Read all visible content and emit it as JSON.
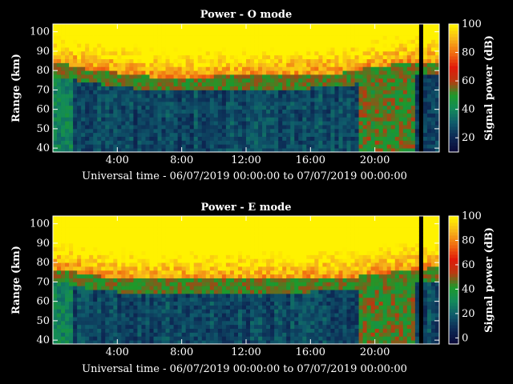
{
  "colors": {
    "background": "#000000",
    "text": "#ffffff",
    "colorscale": [
      "#0b0b3a",
      "#0d2a55",
      "#0f5a6b",
      "#138a5a",
      "#1d9a2a",
      "#b83a10",
      "#e01a0a",
      "#f06a10",
      "#f6b21a",
      "#fff200"
    ]
  },
  "chart_data": [
    {
      "type": "heatmap",
      "title": "Power - O mode",
      "xlabel": "Universal time - 06/07/2019 00:00:00 to 07/07/2019 00:00:00",
      "ylabel": "Range (km)",
      "x_range_hours": [
        0,
        24
      ],
      "y_range_km": [
        38,
        104
      ],
      "xticks": [
        "4:00",
        "8:00",
        "12:00",
        "16:00",
        "20:00"
      ],
      "xtick_hours": [
        4,
        8,
        12,
        16,
        20
      ],
      "yticks": [
        "40",
        "50",
        "60",
        "70",
        "80",
        "90",
        "100"
      ],
      "ytick_km": [
        40,
        50,
        60,
        70,
        80,
        90,
        100
      ],
      "colorbar_label": "Signal power (dB)",
      "colorbar_range": [
        10,
        100
      ],
      "colorbar_ticks": [
        "20",
        "40",
        "60",
        "80",
        "100"
      ],
      "colorbar_tick_values": [
        20,
        40,
        60,
        80,
        100
      ],
      "transition_km_by_hour": {
        "hours": [
          0,
          1,
          2,
          3,
          4,
          6,
          8,
          10,
          12,
          14,
          16,
          18,
          20,
          22,
          23.3
        ],
        "km": [
          79,
          79,
          77,
          76,
          75,
          73,
          72,
          73,
          73,
          73,
          74,
          75,
          78,
          80,
          80
        ]
      },
      "data_gap_hour": 22.9
    },
    {
      "type": "heatmap",
      "title": "Power - E mode",
      "xlabel": "Universal time - 06/07/2019 00:00:00 to 07/07/2019 00:00:00",
      "ylabel": "Range (km)",
      "x_range_hours": [
        0,
        24
      ],
      "y_range_km": [
        38,
        104
      ],
      "xticks": [
        "4:00",
        "8:00",
        "12:00",
        "16:00",
        "20:00"
      ],
      "xtick_hours": [
        4,
        8,
        12,
        16,
        20
      ],
      "yticks": [
        "40",
        "50",
        "60",
        "70",
        "80",
        "90",
        "100"
      ],
      "ytick_km": [
        40,
        50,
        60,
        70,
        80,
        90,
        100
      ],
      "colorbar_label": "Signal power (dB)",
      "colorbar_range": [
        -5,
        100
      ],
      "colorbar_ticks": [
        "0",
        "20",
        "40",
        "60",
        "80",
        "100"
      ],
      "colorbar_tick_values": [
        0,
        20,
        40,
        60,
        80,
        100
      ],
      "transition_km_by_hour": {
        "hours": [
          0,
          1,
          2,
          3,
          4,
          6,
          8,
          10,
          12,
          14,
          16,
          18,
          20,
          22,
          23.3
        ],
        "km": [
          73,
          72,
          70,
          69,
          68,
          67,
          67,
          67,
          67,
          67,
          68,
          68,
          70,
          72,
          73
        ]
      },
      "data_gap_hour": 22.9
    }
  ]
}
